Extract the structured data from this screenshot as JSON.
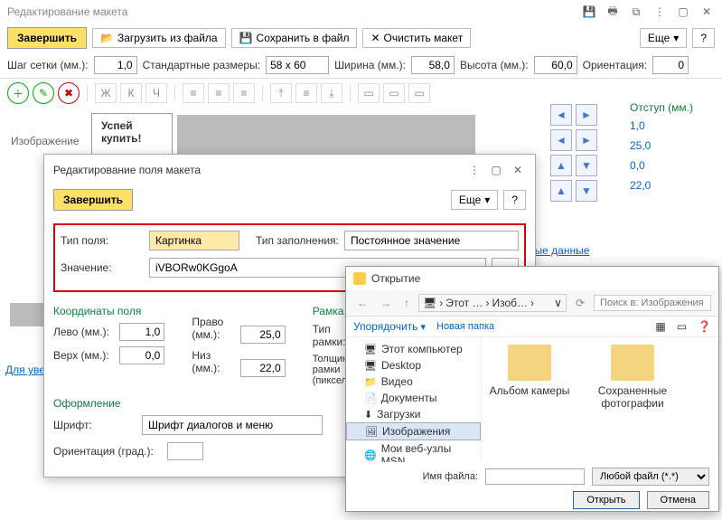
{
  "titlebar": {
    "title": "Редактирование макета"
  },
  "toolbar": {
    "finish": "Завершить",
    "load": "Загрузить из файла",
    "save": "Сохранить в файл",
    "clear": "Очистить макет",
    "more": "Еще",
    "help": "?"
  },
  "params": {
    "grid_label": "Шаг сетки (мм.):",
    "grid_value": "1,0",
    "std_label": "Стандартные размеры:",
    "std_value": "58 x 60",
    "width_label": "Ширина (мм.):",
    "width_value": "58,0",
    "height_label": "Высота (мм.):",
    "height_value": "60,0",
    "orient_label": "Ориентация:",
    "orient_value": "0"
  },
  "format_btns": [
    "Ж",
    "К",
    "Ч"
  ],
  "canvas": {
    "left_label": "Изображение",
    "promo_line1": "Успей",
    "promo_line2": "купить!",
    "zoom_note": "Для увели",
    "data_link": "тельные данные"
  },
  "indent": {
    "header": "Отступ (мм.)",
    "v1": "1,0",
    "v2": "25,0",
    "v3": "0,0",
    "v4": "22,0"
  },
  "modal": {
    "title": "Редактирование поля макета",
    "finish": "Завершить",
    "more": "Еще",
    "help": "?",
    "field_type_label": "Тип поля:",
    "field_type_value": "Картинка",
    "fill_type_label": "Тип заполнения:",
    "fill_type_value": "Постоянное значение",
    "value_label": "Значение:",
    "value_text": "iVBORw0KGgoA",
    "coords_header": "Координаты поля",
    "left_label": "Лево (мм.):",
    "left_val": "1,0",
    "top_label": "Верх (мм.):",
    "top_val": "0,0",
    "right_label": "Право (мм.):",
    "right_val": "25,0",
    "bottom_label": "Низ (мм.):",
    "bottom_val": "22,0",
    "frame_header": "Рамка",
    "frame_type_label": "Тип рамки:",
    "frame_thick_label": "Толщина рамки (пиксели):",
    "design_header": "Оформление",
    "font_label": "Шрифт:",
    "font_value": "Шрифт диалогов и меню",
    "orient_label": "Ориентация (град.):"
  },
  "filedlg": {
    "title": "Открытие",
    "crumb1": "Этот …",
    "crumb2": "Изоб…",
    "search_ph": "Поиск в: Изображения",
    "organize": "Упорядочить",
    "newfolder": "Новая папка",
    "tree": [
      "Этот компьютер",
      "Desktop",
      "Видео",
      "Документы",
      "Загрузки",
      "Изображения",
      "Мои веб-узлы MSN"
    ],
    "folder1": "Альбом камеры",
    "folder2": "Сохраненные фотографии",
    "filename_label": "Имя файла:",
    "filter": "Любой файл (*.*)",
    "open": "Открыть",
    "cancel": "Отмена"
  }
}
